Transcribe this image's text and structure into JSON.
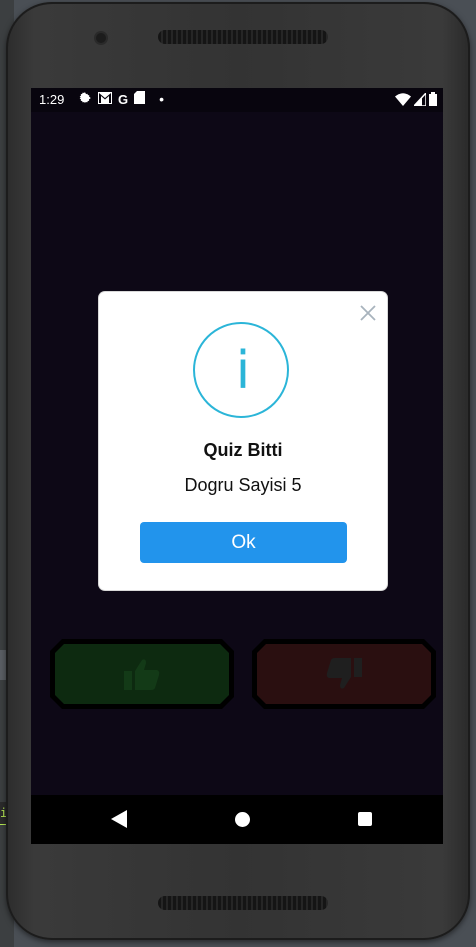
{
  "status_bar": {
    "time": "1:29",
    "icons": [
      "settings-icon",
      "gmail-icon",
      "google-icon",
      "sd-card-icon",
      "dot-icon"
    ],
    "right_icons": [
      "wifi-icon",
      "signal-icon",
      "battery-icon"
    ]
  },
  "dialog": {
    "icon": "info-icon",
    "icon_glyph": "i",
    "title": "Quiz Bitti",
    "message": "Dogru Sayisi 5",
    "ok_label": "Ok",
    "accent_color": "#2bb5d8",
    "button_color": "#2294ec"
  },
  "answer_buttons": {
    "correct": {
      "icon": "thumbs-up-icon",
      "color": "#0d2a10"
    },
    "wrong": {
      "icon": "thumbs-down-icon",
      "color": "#2a0f10"
    }
  },
  "colors": {
    "screen_background": "#0d0816",
    "nav_background": "#000000"
  }
}
